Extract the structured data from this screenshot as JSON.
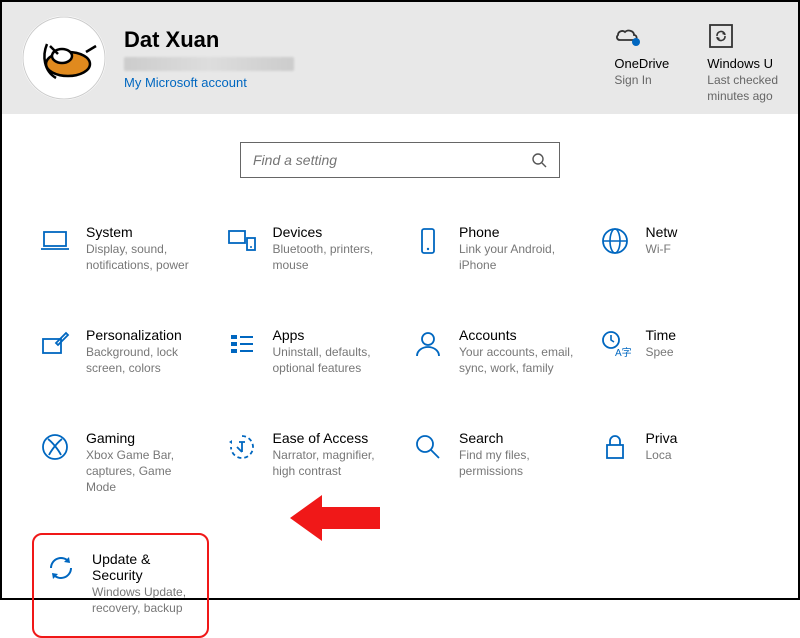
{
  "user": {
    "name": "Dat Xuan",
    "account_link": "My Microsoft account"
  },
  "header_items": {
    "onedrive": {
      "title": "OneDrive",
      "sub": "Sign In"
    },
    "winupdate": {
      "title": "Windows U",
      "sub1": "Last checked",
      "sub2": "minutes ago"
    }
  },
  "search": {
    "placeholder": "Find a setting"
  },
  "categories": {
    "system": {
      "title": "System",
      "desc": "Display, sound, notifications, power"
    },
    "devices": {
      "title": "Devices",
      "desc": "Bluetooth, printers, mouse"
    },
    "phone": {
      "title": "Phone",
      "desc": "Link your Android, iPhone"
    },
    "network": {
      "title": "Netw",
      "desc": "Wi-F"
    },
    "personal": {
      "title": "Personalization",
      "desc": "Background, lock screen, colors"
    },
    "apps": {
      "title": "Apps",
      "desc": "Uninstall, defaults, optional features"
    },
    "accounts": {
      "title": "Accounts",
      "desc": "Your accounts, email, sync, work, family"
    },
    "time": {
      "title": "Time",
      "desc": "Spee"
    },
    "gaming": {
      "title": "Gaming",
      "desc": "Xbox Game Bar, captures, Game Mode"
    },
    "ease": {
      "title": "Ease of Access",
      "desc": "Narrator, magnifier, high contrast"
    },
    "searchc": {
      "title": "Search",
      "desc": "Find my files, permissions"
    },
    "privacy": {
      "title": "Priva",
      "desc": "Loca"
    },
    "update": {
      "title": "Update & Security",
      "desc": "Windows Update, recovery, backup"
    }
  },
  "colors": {
    "accent": "#0067c0",
    "highlight": "#f01818"
  }
}
